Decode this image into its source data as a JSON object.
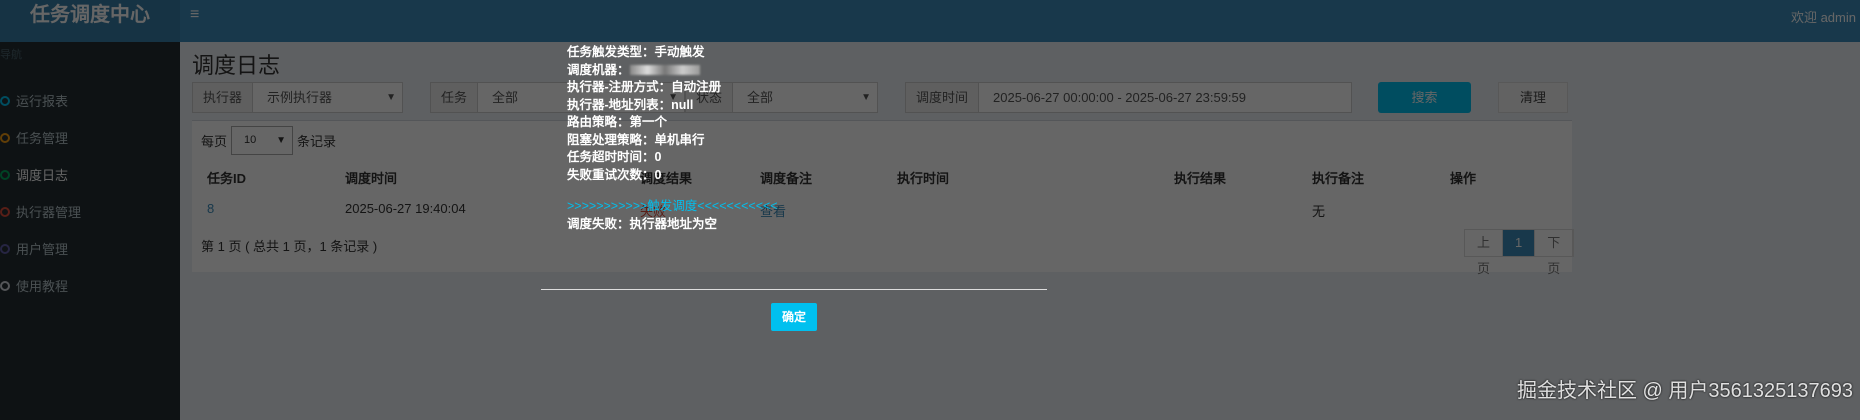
{
  "header": {
    "logo": "任务调度中心",
    "menu_icon": "≡",
    "welcome": "欢迎 admin"
  },
  "sidebar": {
    "heading": "导航",
    "items": [
      {
        "label": "运行报表",
        "color": "#00c0ef"
      },
      {
        "label": "任务管理",
        "color": "#f39c12"
      },
      {
        "label": "调度日志",
        "color": "#00a65a"
      },
      {
        "label": "执行器管理",
        "color": "#dd4b39"
      },
      {
        "label": "用户管理",
        "color": "#605ca8"
      },
      {
        "label": "使用教程",
        "color": "#d2d6de"
      }
    ]
  },
  "page": {
    "title": "调度日志"
  },
  "filters": {
    "executor_label": "执行器",
    "executor_value": "示例执行器",
    "job_label": "任务",
    "job_value": "全部",
    "status_label": "状态",
    "status_value": "全部",
    "time_label": "调度时间",
    "time_value": "2025-06-27 00:00:00 - 2025-06-27 23:59:59",
    "search": "搜索",
    "clear": "清理"
  },
  "table": {
    "per_page_prefix": "每页",
    "per_page_value": "10",
    "per_page_suffix": "条记录",
    "columns": [
      "任务ID",
      "调度时间",
      "调度结果",
      "调度备注",
      "执行时间",
      "执行结果",
      "执行备注",
      "操作"
    ],
    "rows": [
      [
        "8",
        "2025-06-27 19:40:04",
        "失败",
        "查看",
        "",
        "",
        "无",
        ""
      ]
    ],
    "page_info": "第 1 页 ( 总共 1 页，1 条记录 )",
    "pager": {
      "prev": "上页",
      "current": "1",
      "next": "下页"
    }
  },
  "dialog": {
    "lines": [
      "任务触发类型：手动触发",
      "调度机器：",
      "执行器-注册方式：自动注册",
      "执行器-地址列表：null",
      "路由策略：第一个",
      "阻塞处理策略：单机串行",
      "任务超时时间：0",
      "失败重试次数：0"
    ],
    "trigger_line": ">>>>>>>>>>>触发调度<<<<<<<<<<<",
    "result_line": "调度失败：执行器地址为空",
    "ok": "确定"
  },
  "watermark": "掘金技术社区 @ 用户3561325137693"
}
